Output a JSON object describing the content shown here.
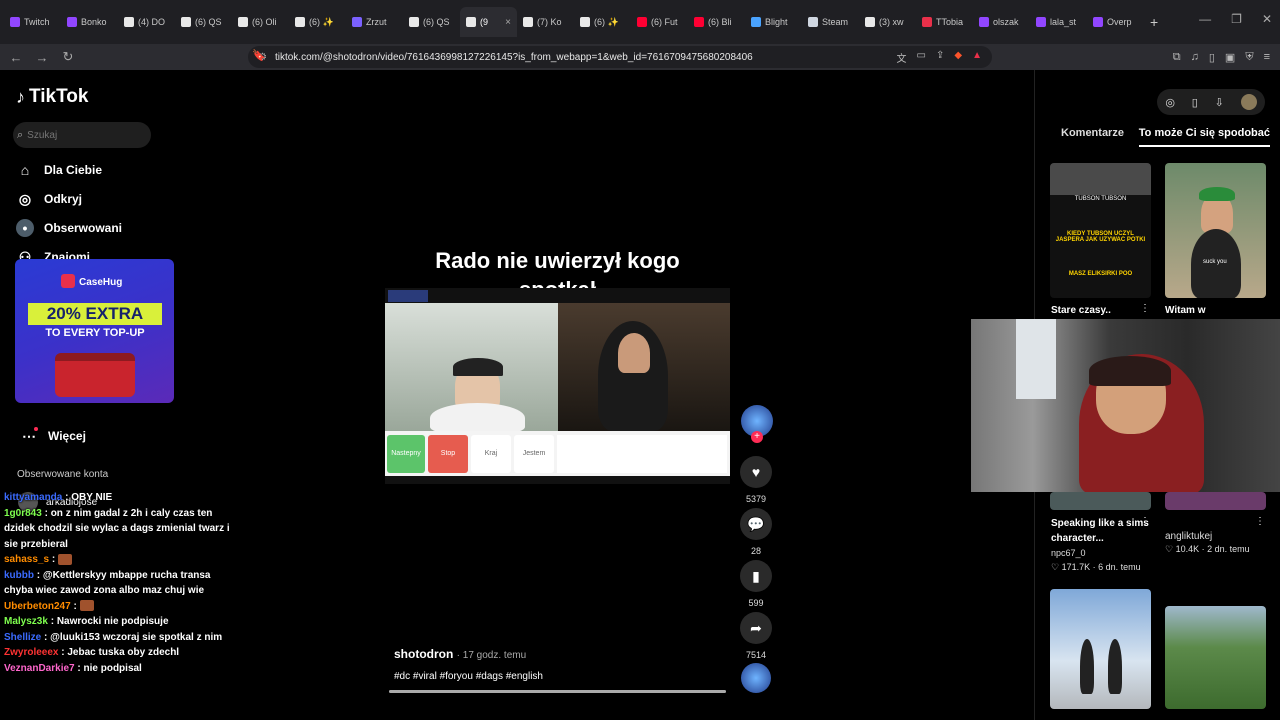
{
  "browser": {
    "tabs": [
      {
        "label": "Twitch",
        "color": "#9146ff"
      },
      {
        "label": "Bonko",
        "color": "#9146ff"
      },
      {
        "label": "(4) DO",
        "color": "#e8e8e8"
      },
      {
        "label": "(6) QS",
        "color": "#e8e8e8"
      },
      {
        "label": "(6) Oli",
        "color": "#e8e8e8"
      },
      {
        "label": "(6) ✨",
        "color": "#e8e8e8"
      },
      {
        "label": "Zrzut",
        "color": "#7b61ff"
      },
      {
        "label": "(6) QS",
        "color": "#e8e8e8"
      },
      {
        "label": "(9",
        "color": "#e8e8e8",
        "active": true
      },
      {
        "label": "(7) Ko",
        "color": "#e8e8e8"
      },
      {
        "label": "(6) ✨",
        "color": "#e8e8e8"
      },
      {
        "label": "(6) Fut",
        "color": "#ff0033"
      },
      {
        "label": "(6) Bli",
        "color": "#ff0033"
      },
      {
        "label": "Blight",
        "color": "#4aa3ff"
      },
      {
        "label": "Steam",
        "color": "#cfd6e0"
      },
      {
        "label": "(3) xw",
        "color": "#e8e8e8"
      },
      {
        "label": "TTobia",
        "color": "#e9304a"
      },
      {
        "label": "olszak",
        "color": "#9146ff"
      },
      {
        "label": "lala_st",
        "color": "#9146ff"
      },
      {
        "label": "Overp",
        "color": "#9146ff"
      }
    ],
    "url": "tiktok.com/@shotodron/video/7616436998127226145?is_from_webapp=1&web_id=7616709475680208406"
  },
  "tiktok": {
    "logo": "TikTok",
    "search_placeholder": "Szukaj",
    "nav": {
      "for_you": "Dla Ciebie",
      "explore": "Odkryj",
      "following": "Obserwowani",
      "friends": "Znajomi",
      "more": "Więcej"
    },
    "followed_accounts_title": "Obserwowane konta",
    "followed_account_1": "arkadiojose"
  },
  "ad": {
    "brand": "CaseHug",
    "line1": "20% EXTRA",
    "line2": "TO EVERY TOP-UP"
  },
  "chat": [
    {
      "user": "kittyamanda",
      "msg": "OBY NIE",
      "color": "#3b6bff"
    },
    {
      "user": "1g0r843",
      "msg": "on z nim gadal z 2h i caly czas ten dzidek chodzil sie wylac a dags zmienial twarz i sie przebieral",
      "color": "#7fff4f"
    },
    {
      "user": "sahass_s",
      "msg": "",
      "color": "#ff8c00"
    },
    {
      "user": "kubbb",
      "msg": "@Kettlerskyy mbappe rucha transa chyba wiec zawod zona albo maz chuj wie",
      "color": "#3b6bff"
    },
    {
      "user": "Uberbeton247",
      "msg": "",
      "color": "#ff8c00"
    },
    {
      "user": "Malysz3k",
      "msg": "Nawrocki nie podpisuje",
      "color": "#7fff4f"
    },
    {
      "user": "Shellize",
      "msg": "@luuki153 wczoraj sie spotkal z nim",
      "color": "#3b6bff"
    },
    {
      "user": "Zwyroleeex",
      "msg": "Jebac tuska oby zdechl",
      "color": "#ff3333"
    },
    {
      "user": "VeznanDarkie7",
      "msg": "nie podpisal",
      "color": "#ff66cc"
    }
  ],
  "video": {
    "caption_line1": "Rado nie uwierzył kogo",
    "caption_line2": "spotkał",
    "author": "shotodron",
    "time": "· 17 godz. temu",
    "tags": "#dc #viral #foryou #dags #english",
    "buttons": [
      "Nastepny",
      "Stop",
      "Kraj",
      "Jestem"
    ],
    "likes": "5379",
    "comments": "28",
    "saves": "599",
    "shares": "7514"
  },
  "right_panel": {
    "tab_comments": "Komentarze",
    "tab_related": "To może Ci się spodobać",
    "cards": [
      {
        "title": "Stare czasy..",
        "meta": ""
      },
      {
        "title": "Witam w",
        "meta": ""
      },
      {
        "title": "Speaking like a sims character...",
        "author": "npc67_0",
        "meta": "♡ 171.7K · 6 dn. temu"
      },
      {
        "title": "angliktukej",
        "author": "",
        "meta": "♡ 10.4K · 2 dn. temu"
      }
    ],
    "thumb1_text": "KIEDY TUBSON UCZYL JASPERA JAK UZYWAC POTKI",
    "thumb1_sub": "MASZ ELIKSIRKI POO",
    "thumb1_names": "TUBSON  TUBSON",
    "thumb2_text": "suck you"
  }
}
